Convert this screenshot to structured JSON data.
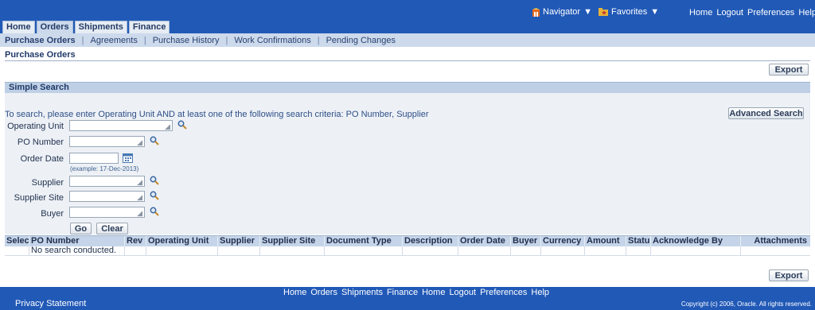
{
  "global": {
    "navigator_label": "Navigator",
    "favorites_label": "Favorites",
    "links": [
      "Home",
      "Logout",
      "Preferences",
      "Help"
    ]
  },
  "tabs": [
    "Home",
    "Orders",
    "Shipments",
    "Finance"
  ],
  "subtabs": [
    "Purchase Orders",
    "Agreements",
    "Purchase History",
    "Work Confirmations",
    "Pending Changes"
  ],
  "page": {
    "title": "Purchase Orders",
    "export_label": "Export"
  },
  "search": {
    "header": "Simple Search",
    "instructions": "To search, please enter Operating Unit AND at least one of the following search criteria: PO Number, Supplier",
    "advanced_label": "Advanced Search",
    "fields": {
      "operating_unit": "Operating Unit",
      "po_number": "PO Number",
      "order_date": "Order Date",
      "supplier": "Supplier",
      "supplier_site": "Supplier Site",
      "buyer": "Buyer"
    },
    "date_hint": "(example: 17-Dec-2013)",
    "go_label": "Go",
    "clear_label": "Clear"
  },
  "table": {
    "columns": [
      "Select",
      "PO Number",
      "Rev",
      "Operating Unit",
      "Supplier",
      "Supplier Site",
      "Document Type",
      "Description",
      "Order Date",
      "Buyer",
      "Currency",
      "Amount",
      "Status",
      "Acknowledge By",
      "Attachments"
    ],
    "empty_message": "No search conducted."
  },
  "footer": {
    "links": [
      "Home",
      "Orders",
      "Shipments",
      "Finance",
      "Home",
      "Logout",
      "Preferences",
      "Help"
    ],
    "privacy": "Privacy Statement",
    "copyright": "Copyright (c) 2006, Oracle. All rights reserved."
  },
  "colors": {
    "brand_blue": "#2159b7",
    "subtab_bg": "#cddaec",
    "search_bg": "#edf1f6"
  }
}
